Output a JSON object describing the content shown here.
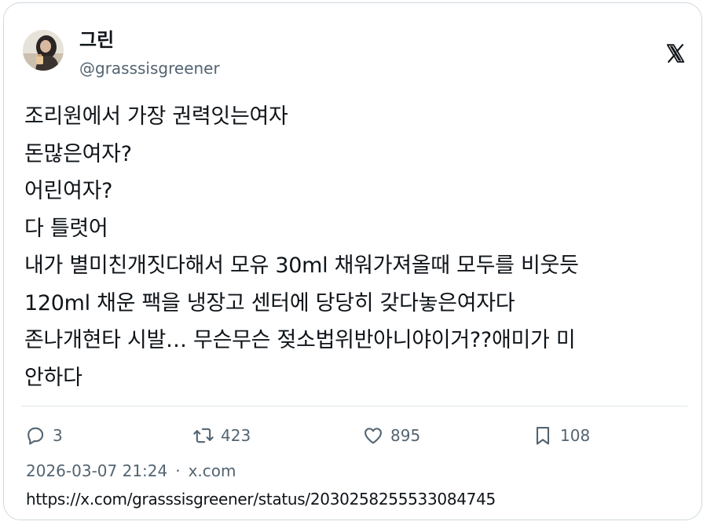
{
  "author": {
    "display_name": "그린",
    "handle": "@grasssisgreener"
  },
  "tweet": {
    "lines": [
      "조리원에서 가장 권력잇는여자",
      "돈많은여자?",
      "어린여자?",
      "다 틀렷어",
      "내가 별미친개짓다해서 모유 30ml 채워가져올때 모두를 비웃듯",
      "120ml 채운 팩을 냉장고 센터에 당당히 갖다놓은여자다",
      "존나개현타 시발… 무슨무슨 젖소법위반아니야이거??애미가 미",
      "안하다"
    ]
  },
  "metrics": {
    "replies": "3",
    "retweets": "423",
    "likes": "895",
    "bookmarks": "108"
  },
  "meta": {
    "timestamp": "2026-03-07 21:24",
    "separator": "·",
    "source": "x.com"
  },
  "status_url": "https://x.com/grasssisgreener/status/2030258255533084745",
  "icons": {
    "brand": "x-logo-icon",
    "reply": "reply-icon",
    "retweet": "retweet-icon",
    "like": "heart-icon",
    "bookmark": "bookmark-icon"
  },
  "colors": {
    "text": "#0f1419",
    "secondary": "#536471",
    "border": "#cfd9de"
  }
}
